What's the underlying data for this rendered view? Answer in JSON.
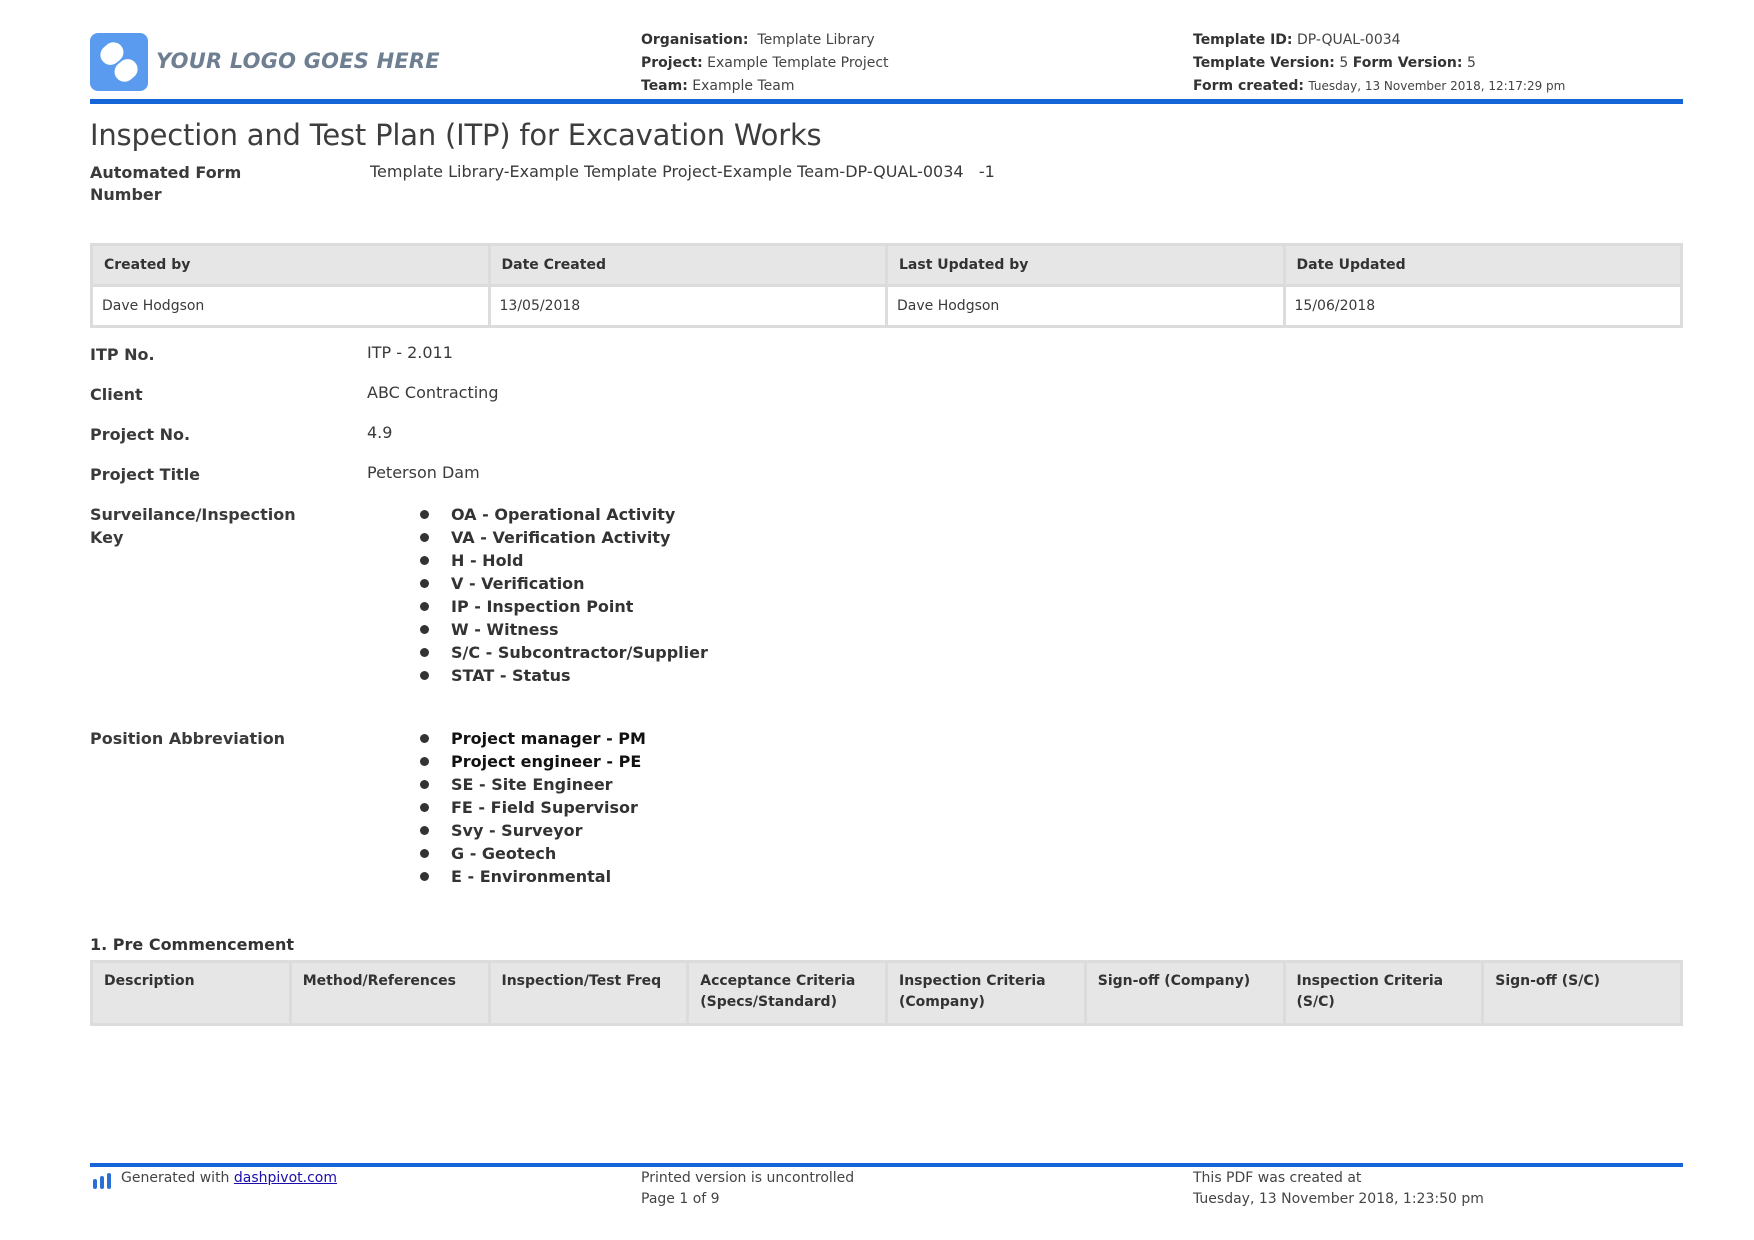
{
  "header": {
    "logo_text": "YOUR LOGO GOES HERE",
    "organisation_label": "Organisation:",
    "organisation": "Template Library",
    "project_label": "Project:",
    "project": "Example Template Project",
    "team_label": "Team:",
    "team": "Example Team",
    "template_id_label": "Template ID:",
    "template_id": "DP-QUAL-0034",
    "template_version_label": "Template Version:",
    "template_version": "5",
    "form_version_label": "Form Version:",
    "form_version": "5",
    "form_created_label": "Form created:",
    "form_created": "Tuesday, 13 November 2018, 12:17:29 pm",
    "accent_color": "#1565d8",
    "logo_color": "#5b9bef"
  },
  "document": {
    "title": "Inspection and Test Plan (ITP) for Excavation Works",
    "automated_form_number_label": "Automated Form Number",
    "automated_form_number": "Template Library-Example Template Project-Example Team-DP-QUAL-0034   -1"
  },
  "meta_table": {
    "headers": [
      "Created by",
      "Date Created",
      "Last Updated by",
      "Date Updated"
    ],
    "values": [
      "Dave Hodgson",
      "13/05/2018",
      "Dave Hodgson",
      "15/06/2018"
    ]
  },
  "fields": [
    {
      "label": "ITP No.",
      "value": "ITP - 2.011"
    },
    {
      "label": "Client",
      "value": "ABC Contracting"
    },
    {
      "label": "Project No.",
      "value": "4.9"
    },
    {
      "label": "Project Title",
      "value": "Peterson Dam"
    }
  ],
  "inspection_key": {
    "label": "Surveilance/Inspection Key",
    "items": [
      "OA - Operational Activity",
      "VA - Verification Activity",
      "H - Hold",
      "V - Verification",
      "IP - Inspection Point",
      "W - Witness",
      "S/C - Subcontractor/Supplier",
      "STAT - Status"
    ]
  },
  "position_abbreviation": {
    "label": "Position Abbreviation",
    "items": [
      "Project manager - PM",
      "Project engineer - PE",
      "SE - Site Engineer",
      "FE - Field Supervisor",
      "Svy - Surveyor",
      "G - Geotech",
      "E - Environmental"
    ]
  },
  "section1": {
    "title": "1. Pre Commencement",
    "columns": [
      "Description",
      "Method/References",
      "Inspection/Test Freq",
      "Acceptance Criteria (Specs/Standard)",
      "Inspection Criteria (Company)",
      "Sign-off (Company)",
      "Inspection Criteria (S/C)",
      "Sign-off (S/C)"
    ]
  },
  "footer": {
    "generated_with": "Generated with",
    "link_text": "dashpivot.com",
    "uncontrolled": "Printed version is uncontrolled",
    "page": "Page 1 of 9",
    "pdf_created_label": "This PDF was created at",
    "pdf_created": "Tuesday, 13 November 2018, 1:23:50 pm"
  }
}
